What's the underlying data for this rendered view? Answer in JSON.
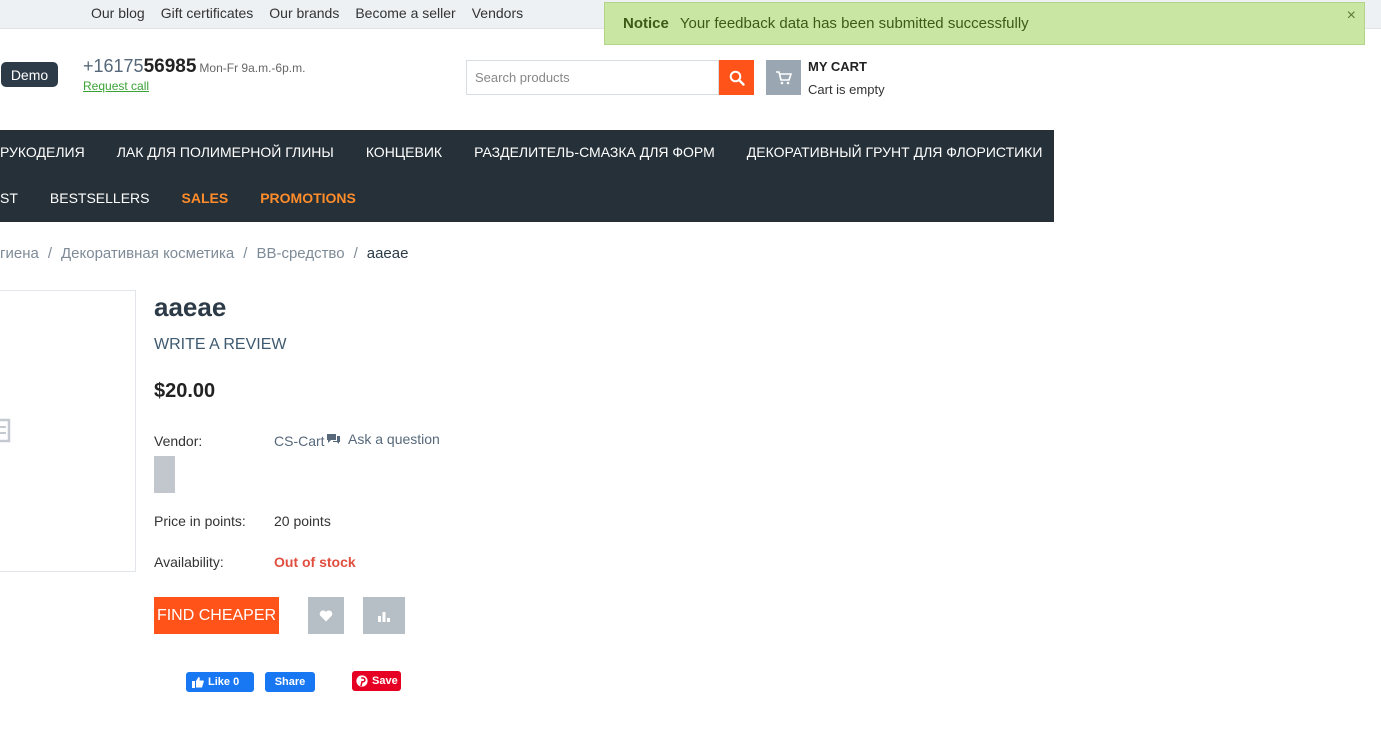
{
  "top_links": [
    "Our blog",
    "Gift certificates",
    "Our brands",
    "Become a seller",
    "Vendors"
  ],
  "notice": {
    "title": "Notice",
    "message": "Your feedback data has been submitted successfully",
    "close": "×"
  },
  "header": {
    "demo_label": "Demo",
    "phone_prefix": "+16175",
    "phone_main": "56985",
    "hours": "Mon-Fr 9a.m.-6p.m.",
    "request_call": "Request call",
    "search_placeholder": "Search products",
    "cart_title": "MY CART",
    "cart_status": "Cart is empty"
  },
  "nav": {
    "row1": [
      "РУКОДЕЛИЯ",
      "ЛАК ДЛЯ ПОЛИМЕРНОЙ ГЛИНЫ",
      "КОНЦЕВИК",
      "РАЗДЕЛИТЕЛЬ-СМАЗКА ДЛЯ ФОРМ",
      "ДЕКОРАТИВНЫЙ ГРУНТ ДЛЯ ФЛОРИСТИКИ"
    ],
    "row2": [
      "ST",
      "BESTSELLERS",
      "SALES",
      "PROMOTIONS"
    ]
  },
  "breadcrumb": [
    "гиена",
    "Декоративная косметика",
    "BB-средство",
    "aaeae"
  ],
  "product": {
    "title": "aaeae",
    "write_review": "WRITE A REVIEW",
    "price": "$20.00",
    "vendor_label": "Vendor:",
    "vendor_name": "CS-Cart",
    "ask_question": "Ask a question",
    "points_label": "Price in points:",
    "points_value": "20 points",
    "availability_label": "Availability:",
    "availability_value": "Out of stock",
    "find_cheaper": "FIND CHEAPER"
  },
  "social": {
    "fb_like": "Like 0",
    "fb_share": "Share",
    "pin_save": "Save"
  },
  "colors": {
    "accent": "#ff5319",
    "nav_bg": "#253038",
    "notice_bg": "#c9e7a3",
    "out_of_stock": "#e04f3f"
  }
}
